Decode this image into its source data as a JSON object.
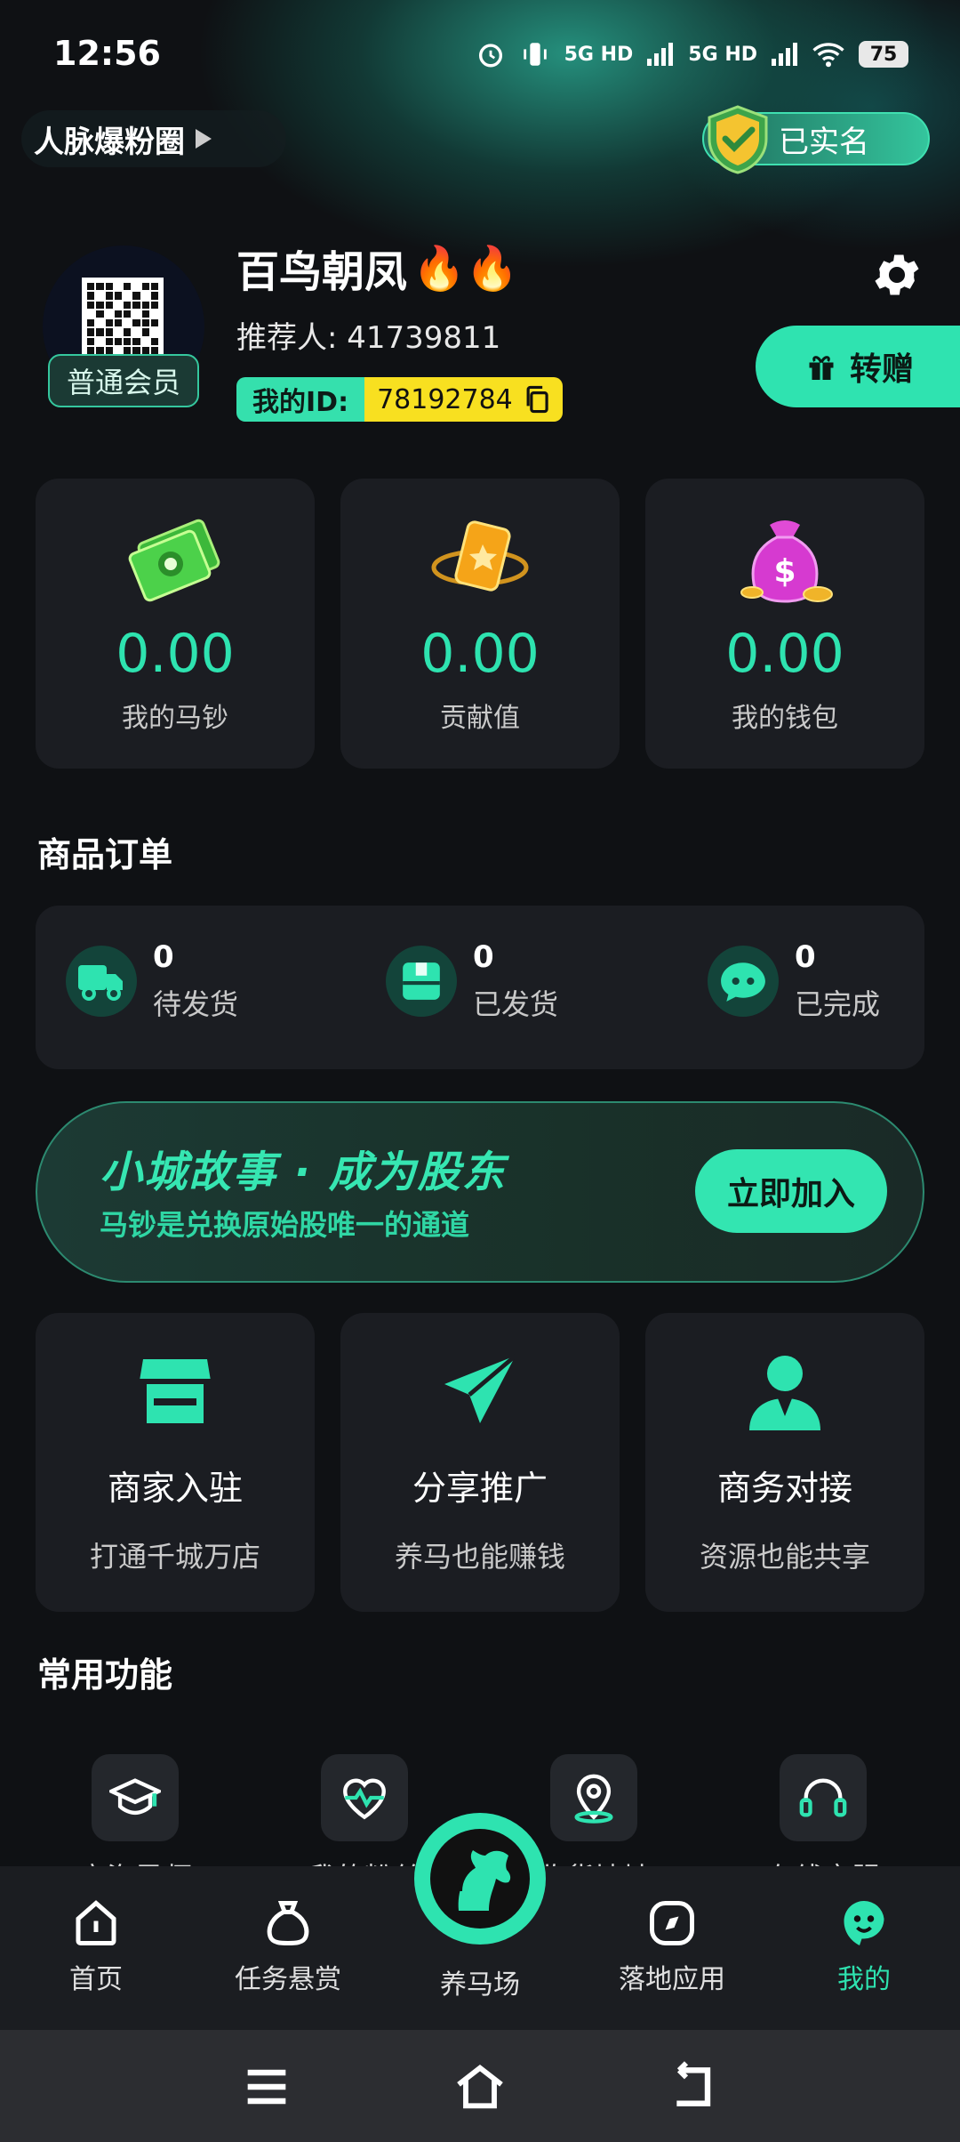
{
  "status_bar": {
    "time": "12:56",
    "signal1": "5G HD",
    "signal2": "5G HD",
    "battery": "75"
  },
  "header": {
    "circle_label": "人脉爆粉圈",
    "verified_label": "已实名"
  },
  "profile": {
    "username": "百鸟朝凤",
    "username_emoji": "🔥🔥",
    "member_level": "普通会员",
    "referrer": "推荐人: 41739811",
    "id_label": "我的ID:",
    "id_value": "78192784",
    "gift_button": "转赠"
  },
  "stats": [
    {
      "value": "0.00",
      "label": "我的马钞",
      "icon": "cash-icon"
    },
    {
      "value": "0.00",
      "label": "贡献值",
      "icon": "gold-card-icon"
    },
    {
      "value": "0.00",
      "label": "我的钱包",
      "icon": "money-bag-icon"
    }
  ],
  "orders": {
    "title": "商品订单",
    "items": [
      {
        "count": "0",
        "label": "待发货",
        "icon": "truck-icon"
      },
      {
        "count": "0",
        "label": "已发货",
        "icon": "package-icon"
      },
      {
        "count": "0",
        "label": "已完成",
        "icon": "chat-bubble-icon"
      }
    ]
  },
  "banner": {
    "title": "小城故事 · 成为股东",
    "subtitle": "马钞是兑换原始股唯一的通道",
    "button": "立即加入"
  },
  "features": [
    {
      "name": "商家入驻",
      "desc": "打通千城万店",
      "icon": "store-icon"
    },
    {
      "name": "分享推广",
      "desc": "养马也能赚钱",
      "icon": "paper-plane-icon"
    },
    {
      "name": "商务对接",
      "desc": "资源也能共享",
      "icon": "support-agent-icon"
    }
  ],
  "common": {
    "title": "常用功能",
    "items": [
      {
        "label": "商海导师",
        "icon": "graduation-cap-icon"
      },
      {
        "label": "我的粉丝",
        "icon": "heart-pulse-icon"
      },
      {
        "label": "收货地址",
        "icon": "location-pin-icon"
      },
      {
        "label": "在线客服",
        "icon": "headset-icon"
      }
    ]
  },
  "nav": {
    "items": [
      {
        "label": "首页",
        "icon": "home-icon"
      },
      {
        "label": "任务悬赏",
        "icon": "bag-icon"
      },
      {
        "label": "养马场",
        "icon": "horse-icon"
      },
      {
        "label": "落地应用",
        "icon": "compass-icon"
      },
      {
        "label": "我的",
        "icon": "profile-face-icon"
      }
    ],
    "active": "我的"
  },
  "colors": {
    "accent": "#2ee3b0",
    "background": "#0f1114",
    "card": "#1b1d22",
    "id_yellow": "#f8e020"
  }
}
